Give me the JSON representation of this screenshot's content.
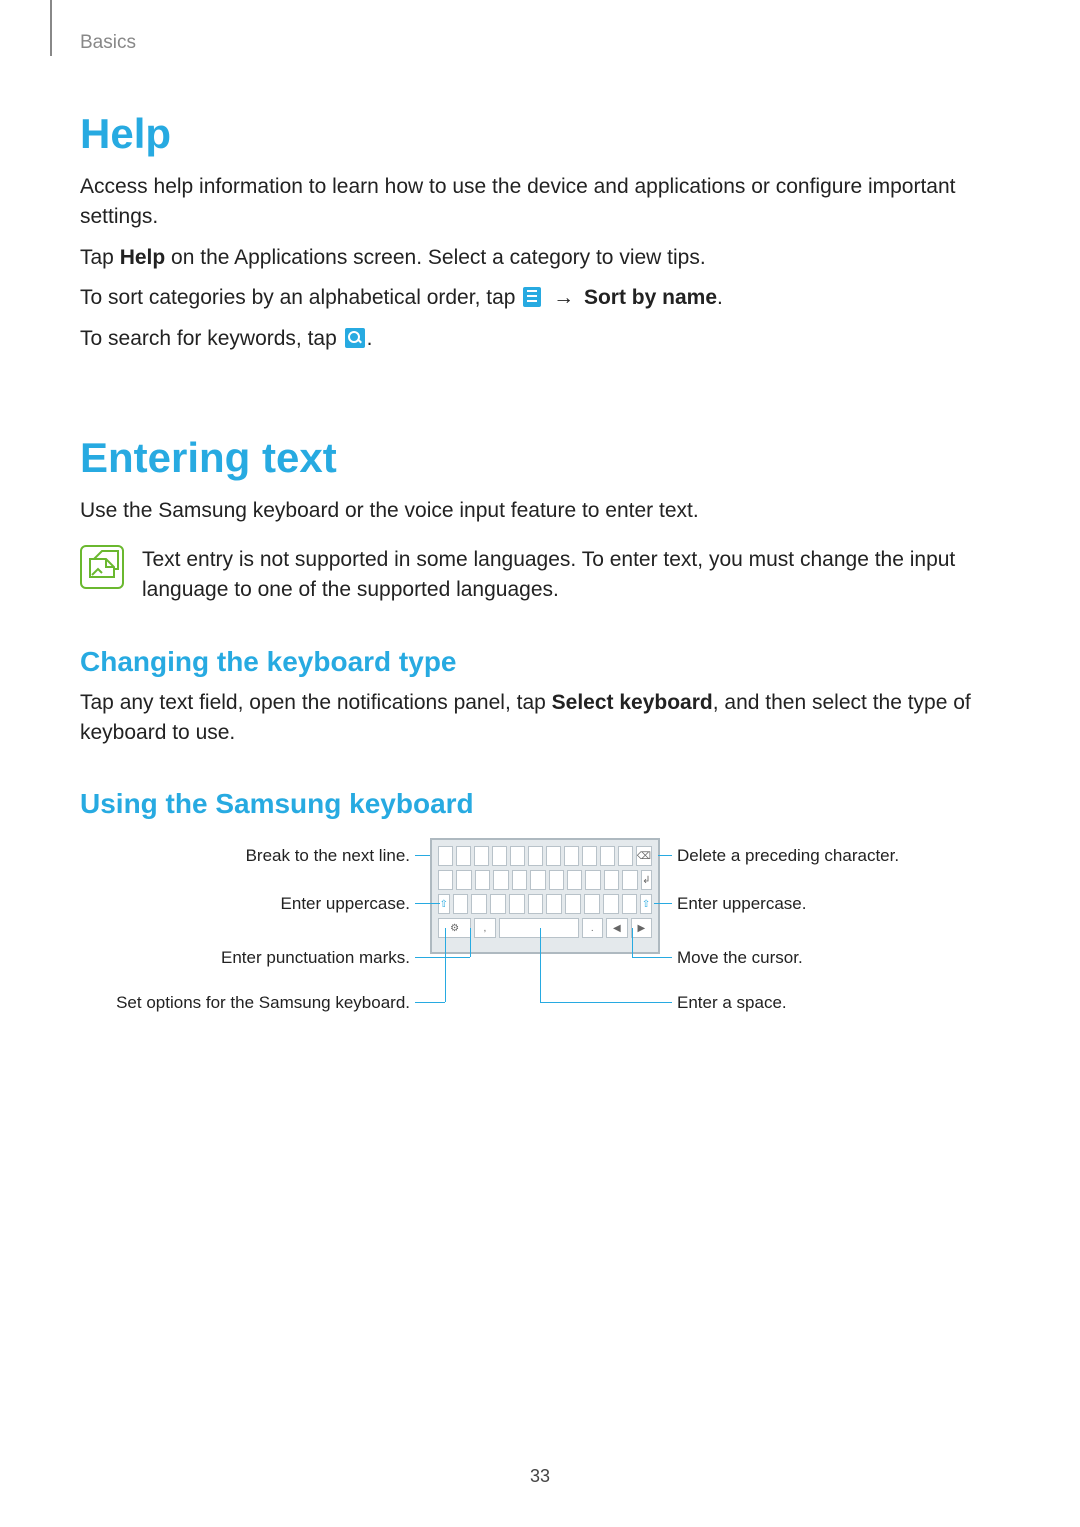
{
  "breadcrumb": "Basics",
  "page_number": "33",
  "help": {
    "title": "Help",
    "p1": "Access help information to learn how to use the device and applications or configure important settings.",
    "p2a": "Tap ",
    "p2b": "Help",
    "p2c": " on the Applications screen. Select a category to view tips.",
    "p3a": "To sort categories by an alphabetical order, tap ",
    "p3_arrow": "→",
    "p3_sort": "Sort by name",
    "p3_end": ".",
    "p4": "To search for keywords, tap ",
    "p4_end": "."
  },
  "entering": {
    "title": "Entering text",
    "p1": "Use the Samsung keyboard or the voice input feature to enter text.",
    "note": "Text entry is not supported in some languages. To enter text, you must change the input language to one of the supported languages."
  },
  "changing": {
    "title": "Changing the keyboard type",
    "p1a": "Tap any text field, open the notifications panel, tap ",
    "p1b": "Select keyboard",
    "p1c": ", and then select the type of keyboard to use."
  },
  "using": {
    "title": "Using the Samsung keyboard"
  },
  "callouts": {
    "left": [
      "Break to the next line.",
      "Enter uppercase.",
      "Enter punctuation marks.",
      "Set options for the Samsung keyboard."
    ],
    "right": [
      "Delete a preceding character.",
      "Enter uppercase.",
      "Move the cursor.",
      "Enter a space."
    ]
  },
  "keyboard_symbols": {
    "shift": "⇧",
    "backspace": "⌫",
    "enter": "↲",
    "gear": "⚙",
    "comma": ",",
    "space": "",
    "period": ".",
    "left": "◀",
    "right": "▶"
  }
}
